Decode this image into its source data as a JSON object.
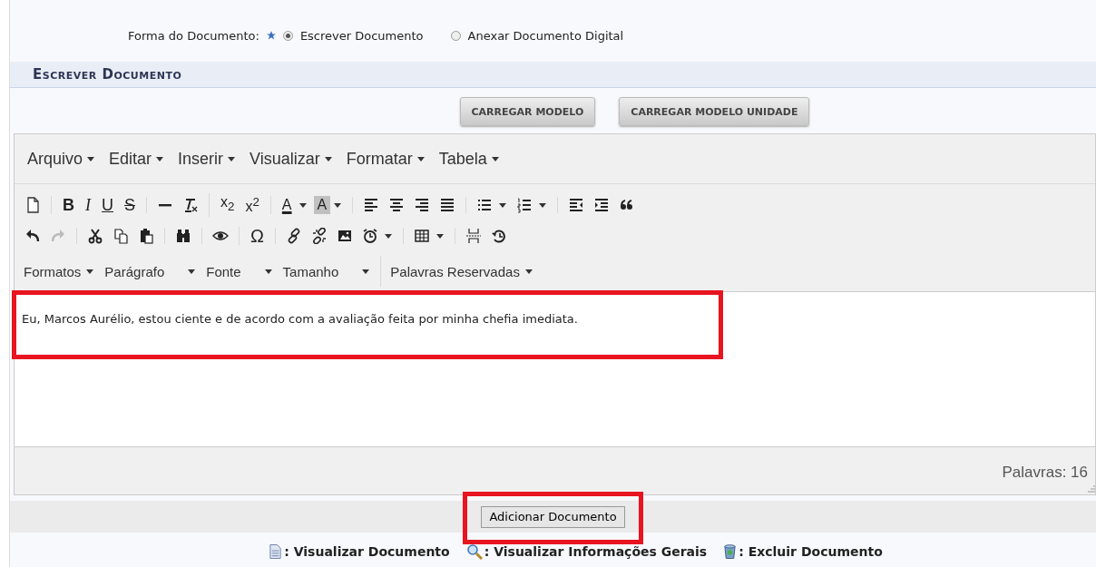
{
  "form": {
    "label": "Forma do Documento:",
    "required": true,
    "options": [
      {
        "label": "Escrever Documento",
        "selected": true
      },
      {
        "label": "Anexar Documento Digital",
        "selected": false
      }
    ]
  },
  "section_title": "Escrever Documento",
  "template_buttons": [
    "CARREGAR MODELO",
    "CARREGAR MODELO UNIDADE"
  ],
  "editor": {
    "menus": [
      "Arquivo",
      "Editar",
      "Inserir",
      "Visualizar",
      "Formatar",
      "Tabela"
    ],
    "toolbar_rows": [
      [
        [
          {
            "kind": "icon"
          }
        ],
        [
          {
            "kind": "bold",
            "text": "B"
          },
          {
            "kind": "italic",
            "text": "I"
          },
          {
            "kind": "underline",
            "text": "U"
          },
          {
            "kind": "strike",
            "text": "S"
          }
        ],
        [
          {
            "kind": "icon"
          },
          {
            "kind": "icon"
          }
        ],
        [
          {
            "kind": "script",
            "text": "x$_{2}$"
          },
          {
            "kind": "script",
            "text": "x$^{2}$"
          }
        ],
        [
          {
            "kind": "color",
            "text": "A"
          },
          {
            "kind": "caret"
          },
          {
            "kind": "bgcolor",
            "text": "A"
          },
          {
            "kind": "caret"
          }
        ],
        [
          {
            "kind": "icon"
          },
          {
            "kind": "icon"
          },
          {
            "kind": "icon"
          },
          {
            "kind": "icon"
          }
        ],
        [
          {
            "kind": "icon"
          },
          {
            "kind": "caret"
          },
          {
            "kind": "icon"
          },
          {
            "kind": "caret"
          }
        ],
        [
          {
            "kind": "icon"
          },
          {
            "kind": "icon"
          },
          {
            "kind": "icon"
          }
        ]
      ],
      [
        [
          {
            "kind": "icon"
          },
          {
            "kind": "icon"
          }
        ],
        [
          {
            "kind": "icon"
          },
          {
            "kind": "icon"
          },
          {
            "kind": "icon"
          }
        ],
        [
          {
            "kind": "icon"
          }
        ],
        [
          {
            "kind": "icon"
          }
        ],
        [
          {
            "kind": "symbol",
            "text": "Ω"
          }
        ],
        [
          {
            "kind": "icon"
          },
          {
            "kind": "icon"
          },
          {
            "kind": "icon"
          },
          {
            "kind": "icon"
          },
          {
            "kind": "caret"
          }
        ],
        [
          {
            "kind": "icon"
          },
          {
            "kind": "caret"
          }
        ],
        [
          {
            "kind": "icon"
          },
          {
            "kind": "icon"
          }
        ]
      ]
    ],
    "formats": [
      {
        "label": "Formatos",
        "wide": false
      },
      {
        "label": "Parágrafo",
        "wide": true
      },
      {
        "label": "Fonte",
        "wide": true
      },
      {
        "label": "Tamanho",
        "wide": true
      },
      {
        "label": "Palavras Reservadas",
        "wide": false
      }
    ],
    "content": "Eu, Marcos Aurélio, estou ciente e de acordo com a avaliação feita por minha chefia imediata.",
    "word_count": "Palavras: 16"
  },
  "add_button": "Adicionar Documento",
  "legend": [
    ": Visualizar Documento",
    ": Visualizar Informações Gerais",
    ": Excluir Documento"
  ]
}
